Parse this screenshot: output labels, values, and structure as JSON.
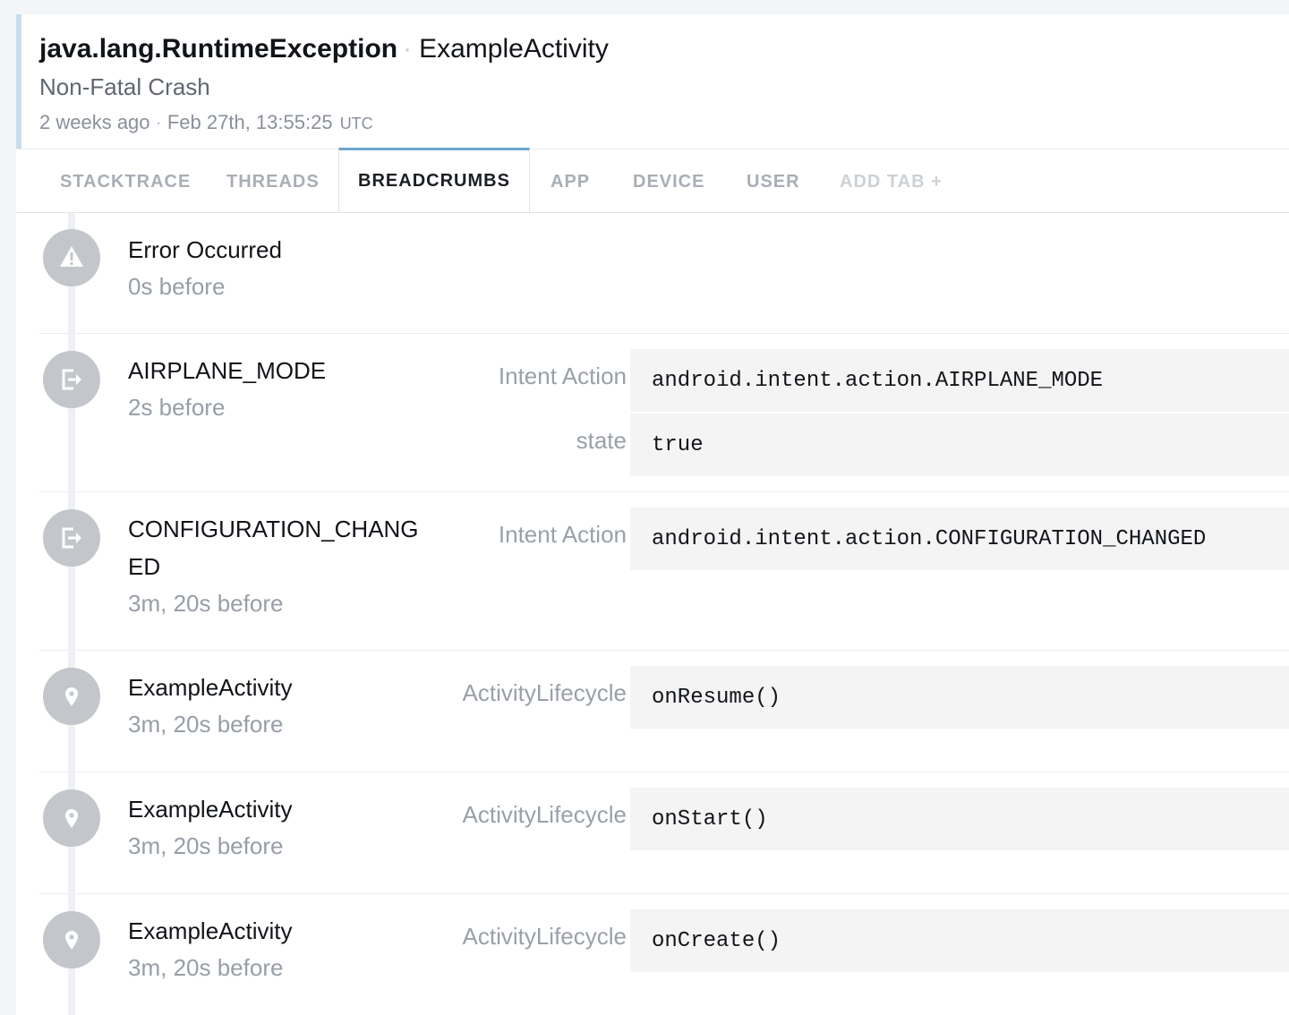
{
  "header": {
    "exception": "java.lang.RuntimeException",
    "separator": "·",
    "context": "ExampleActivity",
    "crash_type": "Non-Fatal Crash",
    "relative_time": "2 weeks ago",
    "timestamp": "Feb 27th, 13:55:25",
    "timezone": "UTC"
  },
  "tabs": [
    {
      "label": "STACKTRACE",
      "active": false
    },
    {
      "label": "THREADS",
      "active": false
    },
    {
      "label": "BREADCRUMBS",
      "active": true
    },
    {
      "label": "APP",
      "active": false
    },
    {
      "label": "DEVICE",
      "active": false
    },
    {
      "label": "USER",
      "active": false
    },
    {
      "label": "ADD TAB +",
      "active": false
    }
  ],
  "colors": {
    "accent": "#6ea6cf",
    "icon_bg": "#c3c6cb",
    "value_bg": "#f4f4f5"
  },
  "breadcrumbs": [
    {
      "icon": "warning-icon",
      "name": "Error Occurred",
      "time": "0s before",
      "meta": []
    },
    {
      "icon": "exit-icon",
      "name": "AIRPLANE_MODE",
      "time": "2s before",
      "meta": [
        {
          "key": "Intent Action",
          "value": "android.intent.action.AIRPLANE_MODE"
        },
        {
          "key": "state",
          "value": "true"
        }
      ]
    },
    {
      "icon": "exit-icon",
      "name": "CONFIGURATION_CHANGED",
      "time": "3m, 20s before",
      "meta": [
        {
          "key": "Intent Action",
          "value": "android.intent.action.CONFIGURATION_CHANGED"
        }
      ]
    },
    {
      "icon": "location-pin-icon",
      "name": "ExampleActivity",
      "time": "3m, 20s before",
      "meta": [
        {
          "key": "ActivityLifecycle",
          "value": "onResume()"
        }
      ]
    },
    {
      "icon": "location-pin-icon",
      "name": "ExampleActivity",
      "time": "3m, 20s before",
      "meta": [
        {
          "key": "ActivityLifecycle",
          "value": "onStart()"
        }
      ]
    },
    {
      "icon": "location-pin-icon",
      "name": "ExampleActivity",
      "time": "3m, 20s before",
      "meta": [
        {
          "key": "ActivityLifecycle",
          "value": "onCreate()"
        }
      ]
    }
  ]
}
